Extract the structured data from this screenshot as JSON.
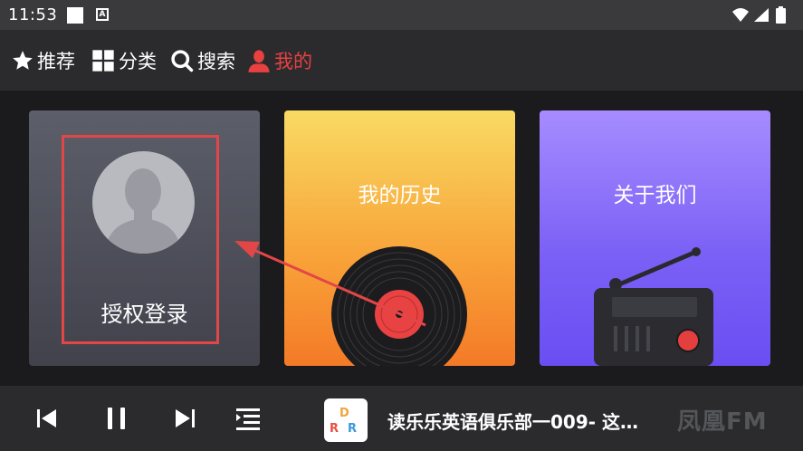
{
  "status_bar": {
    "time": "11:53",
    "notification_letter": "A",
    "icons": [
      "wifi-icon",
      "signal-icon",
      "battery-icon"
    ]
  },
  "nav": {
    "items": [
      {
        "label": "推荐",
        "icon": "star-icon",
        "active": false
      },
      {
        "label": "分类",
        "icon": "grid-icon",
        "active": false
      },
      {
        "label": "搜索",
        "icon": "search-icon",
        "active": false
      },
      {
        "label": "我的",
        "icon": "user-icon",
        "active": true
      }
    ],
    "active_color": "#e94040"
  },
  "cards": {
    "login": {
      "label": "授权登录",
      "icon": "avatar-icon"
    },
    "history": {
      "label": "我的历史",
      "icon": "vinyl-record-icon"
    },
    "about": {
      "label": "关于我们",
      "icon": "radio-icon"
    }
  },
  "player": {
    "controls": [
      "previous-icon",
      "pause-icon",
      "next-icon",
      "playlist-icon"
    ],
    "thumb_letters": [
      "D",
      "R",
      "R"
    ],
    "track_title": "读乐乐英语俱乐部一009- 这…",
    "brand": "凤凰FM"
  },
  "colors": {
    "highlight_red": "#e34646",
    "history_gradient": [
      "#f9da63",
      "#f47a27"
    ],
    "about_gradient": [
      "#a68cff",
      "#6a4ef2"
    ]
  }
}
